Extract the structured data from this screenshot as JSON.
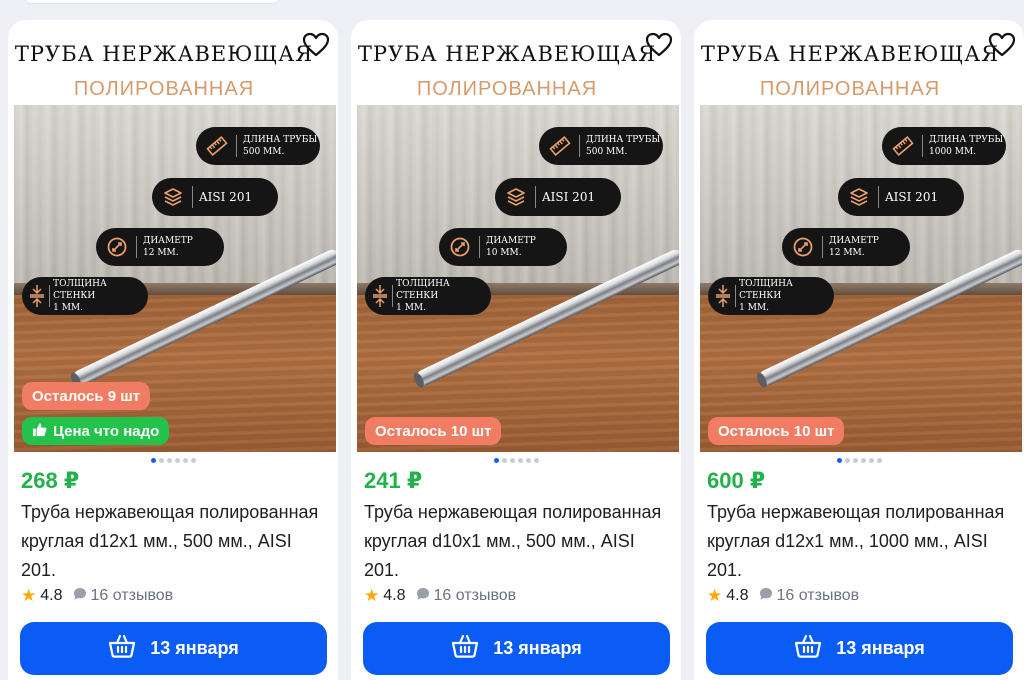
{
  "products": [
    {
      "banner_title": "ТРУБА НЕРЖАВЕЮЩАЯ",
      "banner_subtitle": "ПОЛИРОВАННАЯ",
      "spec_length_label": "ДЛИНА ТРУБЫ",
      "spec_length_value": "500 ММ.",
      "spec_grade": "AISI 201",
      "spec_diameter_label": "ДИАМЕТР",
      "spec_diameter_value": "12 ММ.",
      "spec_wall_label": "ТОЛЩИНА СТЕНКИ",
      "spec_wall_value": "1 ММ.",
      "stock_badge": "Осталось 9 шт",
      "deal_badge": "Цена что надо",
      "price": "268 ₽",
      "title": "Труба нержавеющая полированная круглая d12x1 мм., 500 мм., AISI 201.",
      "rating": "4.8",
      "reviews": "16 отзывов",
      "delivery": "13 января",
      "image_dots": 6,
      "active_dot": 0
    },
    {
      "banner_title": "ТРУБА НЕРЖАВЕЮЩАЯ",
      "banner_subtitle": "ПОЛИРОВАННАЯ",
      "spec_length_label": "ДЛИНА ТРУБЫ",
      "spec_length_value": "500 ММ.",
      "spec_grade": "AISI 201",
      "spec_diameter_label": "ДИАМЕТР",
      "spec_diameter_value": "10 ММ.",
      "spec_wall_label": "ТОЛЩИНА СТЕНКИ",
      "spec_wall_value": "1 ММ.",
      "stock_badge": "Осталось 10 шт",
      "deal_badge": "",
      "price": "241 ₽",
      "title": "Труба нержавеющая полированная круглая d10x1 мм., 500 мм., AISI 201.",
      "rating": "4.8",
      "reviews": "16 отзывов",
      "delivery": "13 января",
      "image_dots": 6,
      "active_dot": 0
    },
    {
      "banner_title": "ТРУБА НЕРЖАВЕЮЩАЯ",
      "banner_subtitle": "ПОЛИРОВАННАЯ",
      "spec_length_label": "ДЛИНА ТРУБЫ",
      "spec_length_value": "1000 ММ.",
      "spec_grade": "AISI 201",
      "spec_diameter_label": "ДИАМЕТР",
      "spec_diameter_value": "12 ММ.",
      "spec_wall_label": "ТОЛЩИНА СТЕНКИ",
      "spec_wall_value": "1 ММ.",
      "stock_badge": "Осталось 10 шт",
      "deal_badge": "",
      "price": "600 ₽",
      "title": "Труба нержавеющая полированная круглая d12x1 мм., 1000 мм., AISI 201.",
      "rating": "4.8",
      "reviews": "16 отзывов",
      "delivery": "13 января",
      "image_dots": 6,
      "active_dot": 0
    }
  ],
  "colors": {
    "price": "#21b24c",
    "accent": "#0a5cf5",
    "stock_badge": "#f07c63",
    "deal_badge": "#22c24b",
    "banner_subtitle": "#d79a6a"
  },
  "icons": {
    "favorite": "heart-outline-icon",
    "length": "ruler-icon",
    "grade": "layers-icon",
    "diameter": "diameter-icon",
    "wall": "thickness-arrows-icon",
    "deal": "thumbs-up-icon",
    "rating": "star-icon",
    "reviews": "chat-bubble-icon",
    "cart": "basket-icon"
  }
}
